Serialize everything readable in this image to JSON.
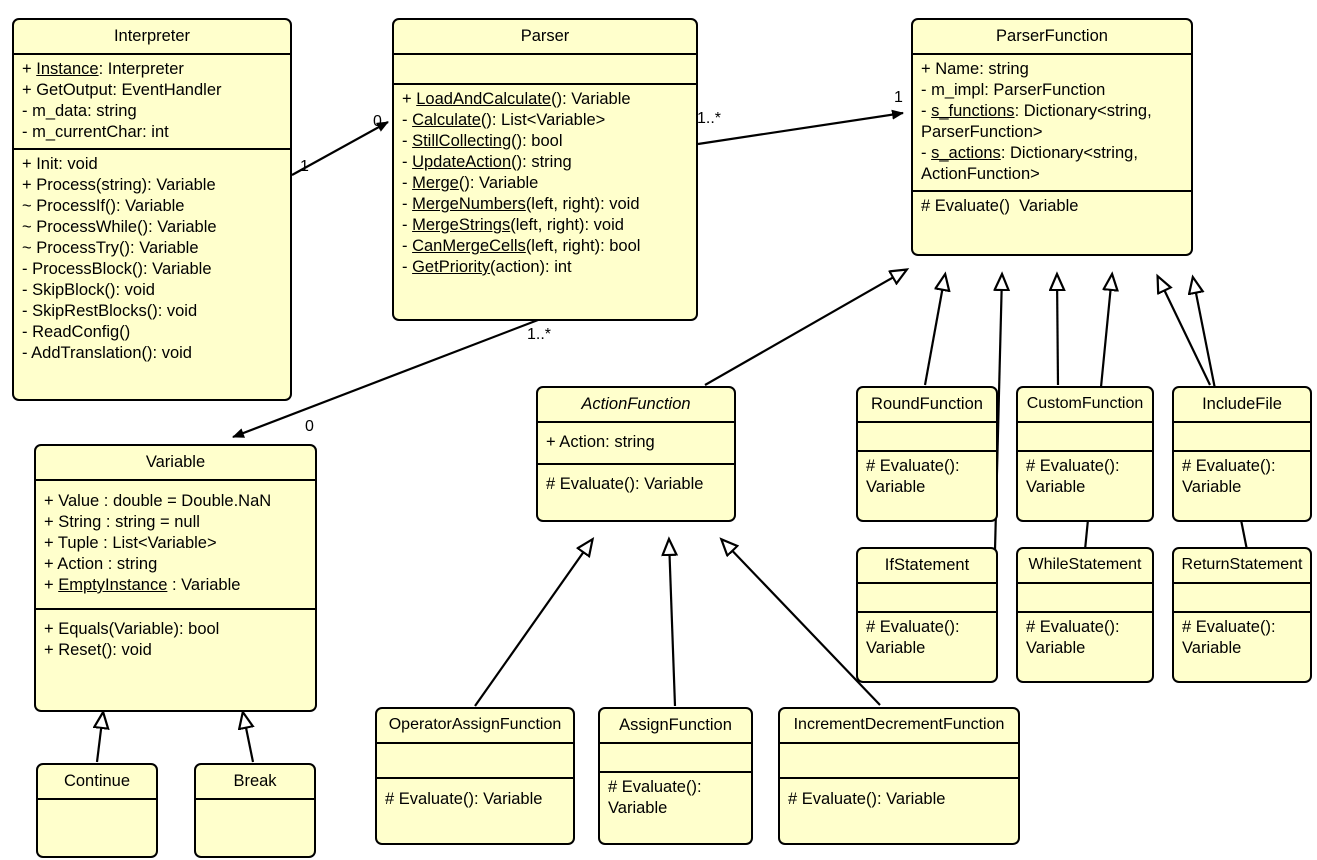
{
  "diagram": {
    "type": "uml-class-diagram",
    "background": "#ffffff",
    "class_fill": "#ffffcc",
    "class_stroke": "#000000"
  },
  "classes": {
    "interpreter": {
      "name": "Interpreter",
      "attributes": [
        "+ Instance: Interpreter",
        "+ GetOutput: EventHandler",
        "- m_data: string",
        "- m_currentChar: int"
      ],
      "methods": [
        "+ Init: void",
        "+ Process(string): Variable",
        "~ ProcessIf(): Variable",
        "~ ProcessWhile(): Variable",
        "~ ProcessTry(): Variable",
        "- ProcessBlock(): Variable",
        "- SkipBlock(): void",
        "- SkipRestBlocks(): void",
        "- ReadConfig()",
        "- AddTranslation(): void"
      ]
    },
    "parser": {
      "name": "Parser",
      "attributes": [],
      "methods": [
        "+ LoadAndCalculate(): Variable",
        "- Calculate(): List<Variable>",
        "- StillCollecting(): bool",
        "- UpdateAction(): string",
        "- Merge(): Variable",
        "- MergeNumbers(left, right): void",
        "- MergeStrings(left, right): void",
        "- CanMergeCells(left, right): bool",
        "- GetPriority(action): int"
      ]
    },
    "parser_function": {
      "name": "ParserFunction",
      "attributes": [
        "+ Name: string",
        "- m_impl: ParserFunction",
        "- s_functions: Dictionary<string, ParserFunction>",
        "- s_actions: Dictionary<string, ActionFunction>"
      ],
      "methods": [
        "# Evaluate()  Variable"
      ]
    },
    "variable": {
      "name": "Variable",
      "attributes": [
        "+ Value : double = Double.NaN",
        "+ String : string = null",
        "+ Tuple : List<Variable>",
        "+ Action : string",
        "+ EmptyInstance : Variable"
      ],
      "methods": [
        "+ Equals(Variable): bool",
        "+ Reset(): void"
      ]
    },
    "action_function": {
      "name": "ActionFunction",
      "abstract": true,
      "attributes": [
        "+ Action: string"
      ],
      "methods": [
        "# Evaluate(): Variable"
      ]
    },
    "continue": {
      "name": "Continue",
      "attributes": [],
      "methods": []
    },
    "break": {
      "name": "Break",
      "attributes": [],
      "methods": []
    },
    "round_function": {
      "name": "RoundFunction",
      "attributes": [],
      "methods": [
        "# Evaluate():\nVariable"
      ]
    },
    "custom_function": {
      "name": "CustomFunction",
      "attributes": [],
      "methods": [
        "# Evaluate():\nVariable"
      ]
    },
    "include_file": {
      "name": "IncludeFile",
      "attributes": [],
      "methods": [
        "# Evaluate():\nVariable"
      ]
    },
    "if_statement": {
      "name": "IfStatement",
      "attributes": [],
      "methods": [
        "# Evaluate():\nVariable"
      ]
    },
    "while_statement": {
      "name": "WhileStatement",
      "attributes": [],
      "methods": [
        "# Evaluate():\nVariable"
      ]
    },
    "return_statement": {
      "name": "ReturnStatement",
      "attributes": [],
      "methods": [
        "# Evaluate():\nVariable"
      ]
    },
    "operator_assign_function": {
      "name": "OperatorAssignFunction",
      "attributes": [],
      "methods": [
        "# Evaluate(): Variable"
      ]
    },
    "assign_function": {
      "name": "AssignFunction",
      "attributes": [],
      "methods": [
        "# Evaluate():\nVariable"
      ]
    },
    "increment_decrement_function": {
      "name": "IncrementDecrementFunction",
      "attributes": [],
      "methods": [
        "# Evaluate(): Variable"
      ]
    }
  },
  "multiplicities": {
    "interpreter_to_parser_source": "1",
    "interpreter_to_parser_target": "0",
    "parser_to_parserfunction_source": "1..*",
    "parser_to_parserfunction_target": "1",
    "parser_to_variable_source": "1..*",
    "parser_to_variable_target": "0"
  },
  "relations": [
    {
      "from": "Interpreter",
      "to": "Parser",
      "kind": "association"
    },
    {
      "from": "Parser",
      "to": "ParserFunction",
      "kind": "association"
    },
    {
      "from": "Parser",
      "to": "Variable",
      "kind": "association"
    },
    {
      "from": "ActionFunction",
      "to": "ParserFunction",
      "kind": "generalization"
    },
    {
      "from": "RoundFunction",
      "to": "ParserFunction",
      "kind": "generalization"
    },
    {
      "from": "IfStatement",
      "to": "ParserFunction",
      "kind": "generalization"
    },
    {
      "from": "CustomFunction",
      "to": "ParserFunction",
      "kind": "generalization"
    },
    {
      "from": "WhileStatement",
      "to": "ParserFunction",
      "kind": "generalization"
    },
    {
      "from": "IncludeFile",
      "to": "ParserFunction",
      "kind": "generalization"
    },
    {
      "from": "ReturnStatement",
      "to": "ParserFunction",
      "kind": "generalization"
    },
    {
      "from": "Continue",
      "to": "Variable",
      "kind": "generalization"
    },
    {
      "from": "Break",
      "to": "Variable",
      "kind": "generalization"
    },
    {
      "from": "OperatorAssignFunction",
      "to": "ActionFunction",
      "kind": "generalization"
    },
    {
      "from": "AssignFunction",
      "to": "ActionFunction",
      "kind": "generalization"
    },
    {
      "from": "IncrementDecrementFunction",
      "to": "ActionFunction",
      "kind": "generalization"
    }
  ]
}
